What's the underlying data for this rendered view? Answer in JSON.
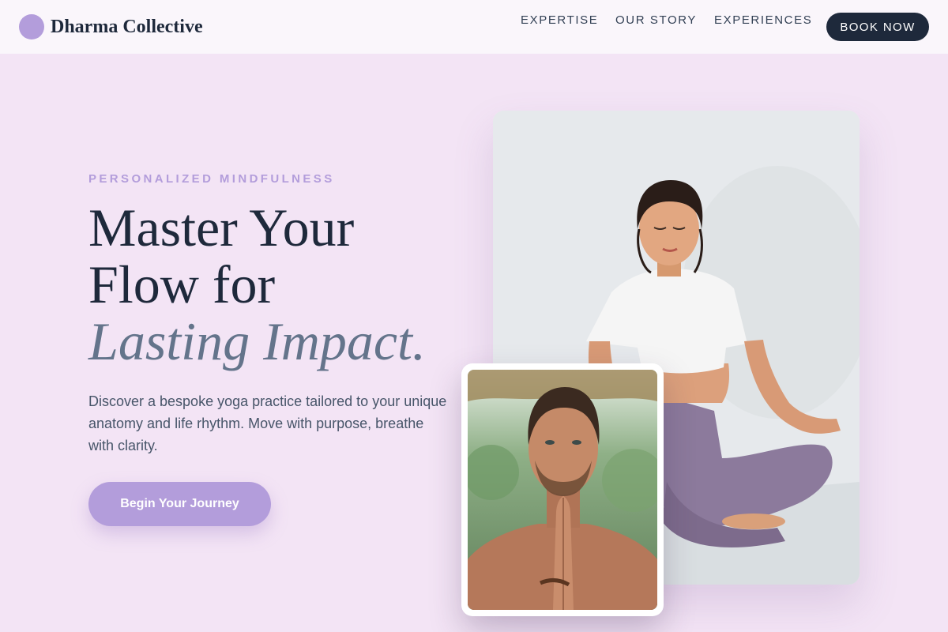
{
  "nav": {
    "brand": "Dharma Collective",
    "links": [
      "EXPERTISE",
      "OUR STORY",
      "EXPERIENCES"
    ],
    "cta": "BOOK NOW"
  },
  "hero": {
    "eyebrow": "PERSONALIZED MINDFULNESS",
    "headline_line1": "Master Your",
    "headline_line2": "Flow for",
    "headline_accent": "Lasting Impact.",
    "intro": "Discover a bespoke yoga practice tailored to your unique anatomy and life rhythm. Move with purpose, breathe with clarity.",
    "cta": "Begin Your Journey"
  },
  "colors": {
    "background": "#f3e4f5",
    "accent": "#b39ddb",
    "dark": "#1e293b"
  }
}
